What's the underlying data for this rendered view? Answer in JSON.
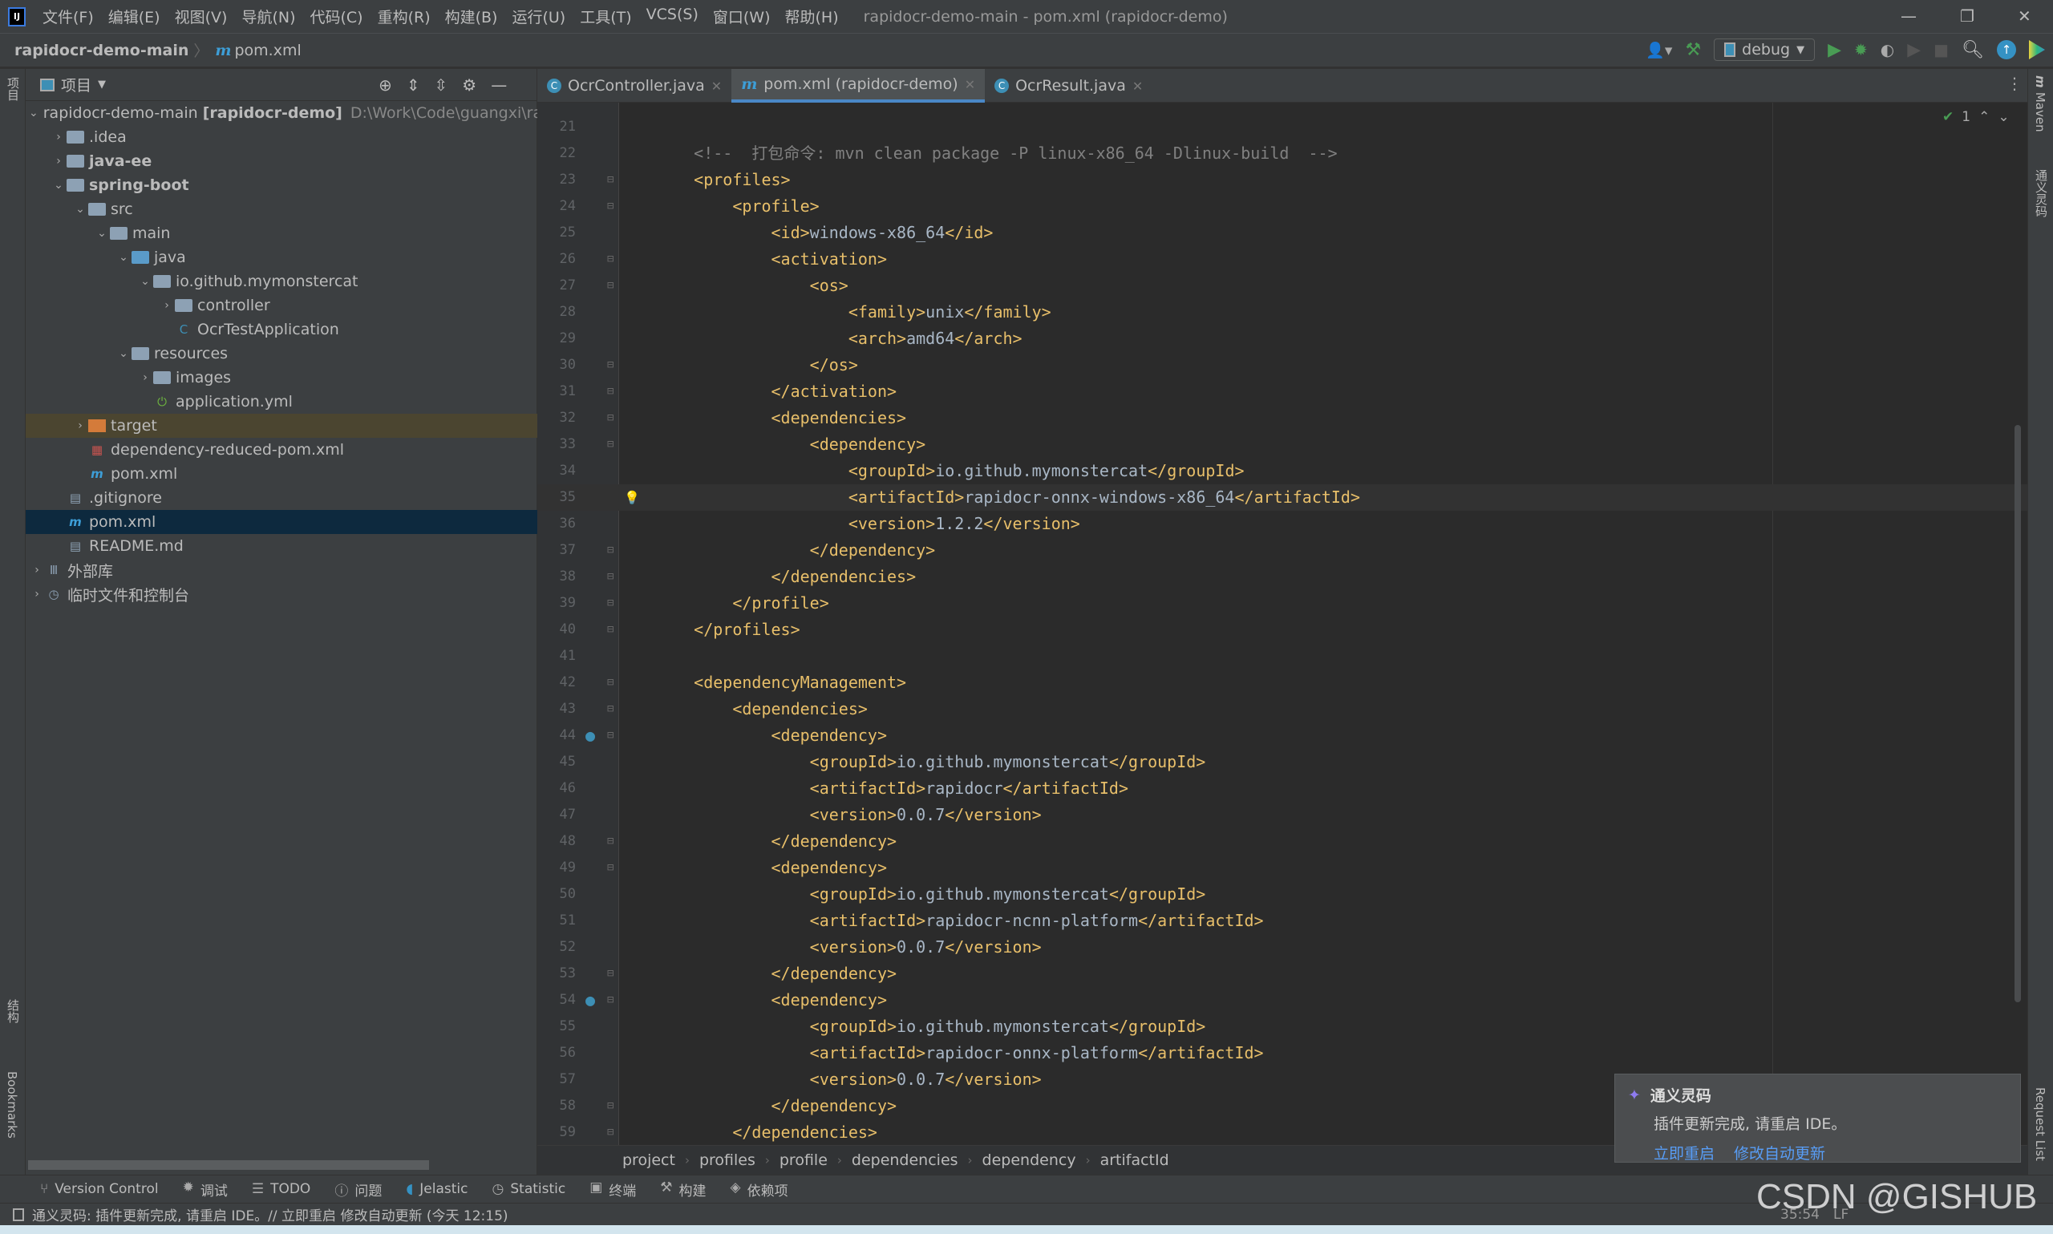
{
  "title": {
    "app_logo": "IJ",
    "menus": [
      "文件(F)",
      "编辑(E)",
      "视图(V)",
      "导航(N)",
      "代码(C)",
      "重构(R)",
      "构建(B)",
      "运行(U)",
      "工具(T)",
      "VCS(S)",
      "窗口(W)",
      "帮助(H)"
    ],
    "window_title": "rapidocr-demo-main - pom.xml (rapidocr-demo)"
  },
  "nav": {
    "project": "rapidocr-demo-main",
    "file": "pom.xml",
    "run_config": "debug"
  },
  "project_panel": {
    "title": "项目",
    "items": [
      {
        "label": "rapidocr-demo-main",
        "bold_suffix": "[rapidocr-demo]",
        "path": "D:\\Work\\Code\\guangxi\\ra",
        "depth": 0,
        "arrow": "v",
        "icon": "folder"
      },
      {
        "label": ".idea",
        "depth": 1,
        "arrow": ">",
        "icon": "folder"
      },
      {
        "label": "java-ee",
        "depth": 1,
        "arrow": ">",
        "icon": "folder",
        "bold": true
      },
      {
        "label": "spring-boot",
        "depth": 1,
        "arrow": "v",
        "icon": "folder",
        "bold": true
      },
      {
        "label": "src",
        "depth": 2,
        "arrow": "v",
        "icon": "folder"
      },
      {
        "label": "main",
        "depth": 3,
        "arrow": "v",
        "icon": "folder"
      },
      {
        "label": "java",
        "depth": 4,
        "arrow": "v",
        "icon": "folder-blue"
      },
      {
        "label": "io.github.mymonstercat",
        "depth": 5,
        "arrow": "v",
        "icon": "package"
      },
      {
        "label": "controller",
        "depth": 6,
        "arrow": ">",
        "icon": "package"
      },
      {
        "label": "OcrTestApplication",
        "depth": 6,
        "arrow": "",
        "icon": "class"
      },
      {
        "label": "resources",
        "depth": 4,
        "arrow": "v",
        "icon": "folder-res"
      },
      {
        "label": "images",
        "depth": 5,
        "arrow": ">",
        "icon": "folder"
      },
      {
        "label": "application.yml",
        "depth": 5,
        "arrow": "",
        "icon": "spring"
      },
      {
        "label": "target",
        "depth": 2,
        "arrow": ">",
        "icon": "folder-orange",
        "state": "target"
      },
      {
        "label": "dependency-reduced-pom.xml",
        "depth": 2,
        "arrow": "",
        "icon": "xml"
      },
      {
        "label": "pom.xml",
        "depth": 2,
        "arrow": "",
        "icon": "maven"
      },
      {
        "label": ".gitignore",
        "depth": 1,
        "arrow": "",
        "icon": "file"
      },
      {
        "label": "pom.xml",
        "depth": 1,
        "arrow": "",
        "icon": "maven",
        "state": "selected"
      },
      {
        "label": "README.md",
        "depth": 1,
        "arrow": "",
        "icon": "file"
      },
      {
        "label": "外部库",
        "depth": 0,
        "arrow": ">",
        "icon": "library"
      },
      {
        "label": "临时文件和控制台",
        "depth": 0,
        "arrow": ">",
        "icon": "scratch"
      }
    ]
  },
  "tabs": [
    {
      "label": "OcrController.java",
      "icon": "C"
    },
    {
      "label": "pom.xml (rapidocr-demo)",
      "icon": "m",
      "active": true
    },
    {
      "label": "OcrResult.java",
      "icon": "C"
    }
  ],
  "editor": {
    "inspection_count": "1",
    "current_line": 35,
    "lines": [
      {
        "n": 21,
        "t": ""
      },
      {
        "n": 22,
        "t": "    <!--  打包命令: mvn clean package -P linux-x86_64 -Dlinux-build  -->",
        "comment": true
      },
      {
        "n": 23,
        "t": "    <profiles>"
      },
      {
        "n": 24,
        "t": "        <profile>"
      },
      {
        "n": 25,
        "t": "            <id>windows-x86_64</id>"
      },
      {
        "n": 26,
        "t": "            <activation>"
      },
      {
        "n": 27,
        "t": "                <os>"
      },
      {
        "n": 28,
        "t": "                    <family>unix</family>"
      },
      {
        "n": 29,
        "t": "                    <arch>amd64</arch>"
      },
      {
        "n": 30,
        "t": "                </os>"
      },
      {
        "n": 31,
        "t": "            </activation>"
      },
      {
        "n": 32,
        "t": "            <dependencies>"
      },
      {
        "n": 33,
        "t": "                <dependency>"
      },
      {
        "n": 34,
        "t": "                    <groupId>io.github.mymonstercat</groupId>"
      },
      {
        "n": 35,
        "t": "                    <artifactId>rapidocr-onnx-windows-x86_64</artifactId>"
      },
      {
        "n": 36,
        "t": "                    <version>1.2.2</version>"
      },
      {
        "n": 37,
        "t": "                </dependency>"
      },
      {
        "n": 38,
        "t": "            </dependencies>"
      },
      {
        "n": 39,
        "t": "        </profile>"
      },
      {
        "n": 40,
        "t": "    </profiles>"
      },
      {
        "n": 41,
        "t": ""
      },
      {
        "n": 42,
        "t": "    <dependencyManagement>"
      },
      {
        "n": 43,
        "t": "        <dependencies>"
      },
      {
        "n": 44,
        "t": "            <dependency>"
      },
      {
        "n": 45,
        "t": "                <groupId>io.github.mymonstercat</groupId>"
      },
      {
        "n": 46,
        "t": "                <artifactId>rapidocr</artifactId>"
      },
      {
        "n": 47,
        "t": "                <version>0.0.7</version>"
      },
      {
        "n": 48,
        "t": "            </dependency>"
      },
      {
        "n": 49,
        "t": "            <dependency>"
      },
      {
        "n": 50,
        "t": "                <groupId>io.github.mymonstercat</groupId>"
      },
      {
        "n": 51,
        "t": "                <artifactId>rapidocr-ncnn-platform</artifactId>"
      },
      {
        "n": 52,
        "t": "                <version>0.0.7</version>"
      },
      {
        "n": 53,
        "t": "            </dependency>"
      },
      {
        "n": 54,
        "t": "            <dependency>"
      },
      {
        "n": 55,
        "t": "                <groupId>io.github.mymonstercat</groupId>"
      },
      {
        "n": 56,
        "t": "                <artifactId>rapidocr-onnx-platform</artifactId>"
      },
      {
        "n": 57,
        "t": "                <version>0.0.7</version>"
      },
      {
        "n": 58,
        "t": "            </dependency>"
      },
      {
        "n": 59,
        "t": "        </dependencies>"
      }
    ]
  },
  "breadcrumbs": [
    "project",
    "profiles",
    "profile",
    "dependencies",
    "dependency",
    "artifactId"
  ],
  "toolwindows": [
    "Version Control",
    "调试",
    "TODO",
    "问题",
    "Jelastic",
    "Statistic",
    "终端",
    "构建",
    "依赖项"
  ],
  "status": {
    "message": "通义灵码: 插件更新完成, 请重启 IDE。// 立即重启  修改自动更新 (今天 12:15)",
    "time": "35:54",
    "lf": "LF"
  },
  "notification": {
    "title": "通义灵码",
    "body": "插件更新完成, 请重启 IDE。",
    "action1": "立即重启",
    "action2": "修改自动更新"
  },
  "side_labels": {
    "left_project": "项目",
    "left_structure": "结构",
    "left_bookmarks": "Bookmarks",
    "right_maven": "Maven",
    "right_tongyi": "通义灵码",
    "right_request": "Request List"
  },
  "watermark": "CSDN @GISHUB"
}
